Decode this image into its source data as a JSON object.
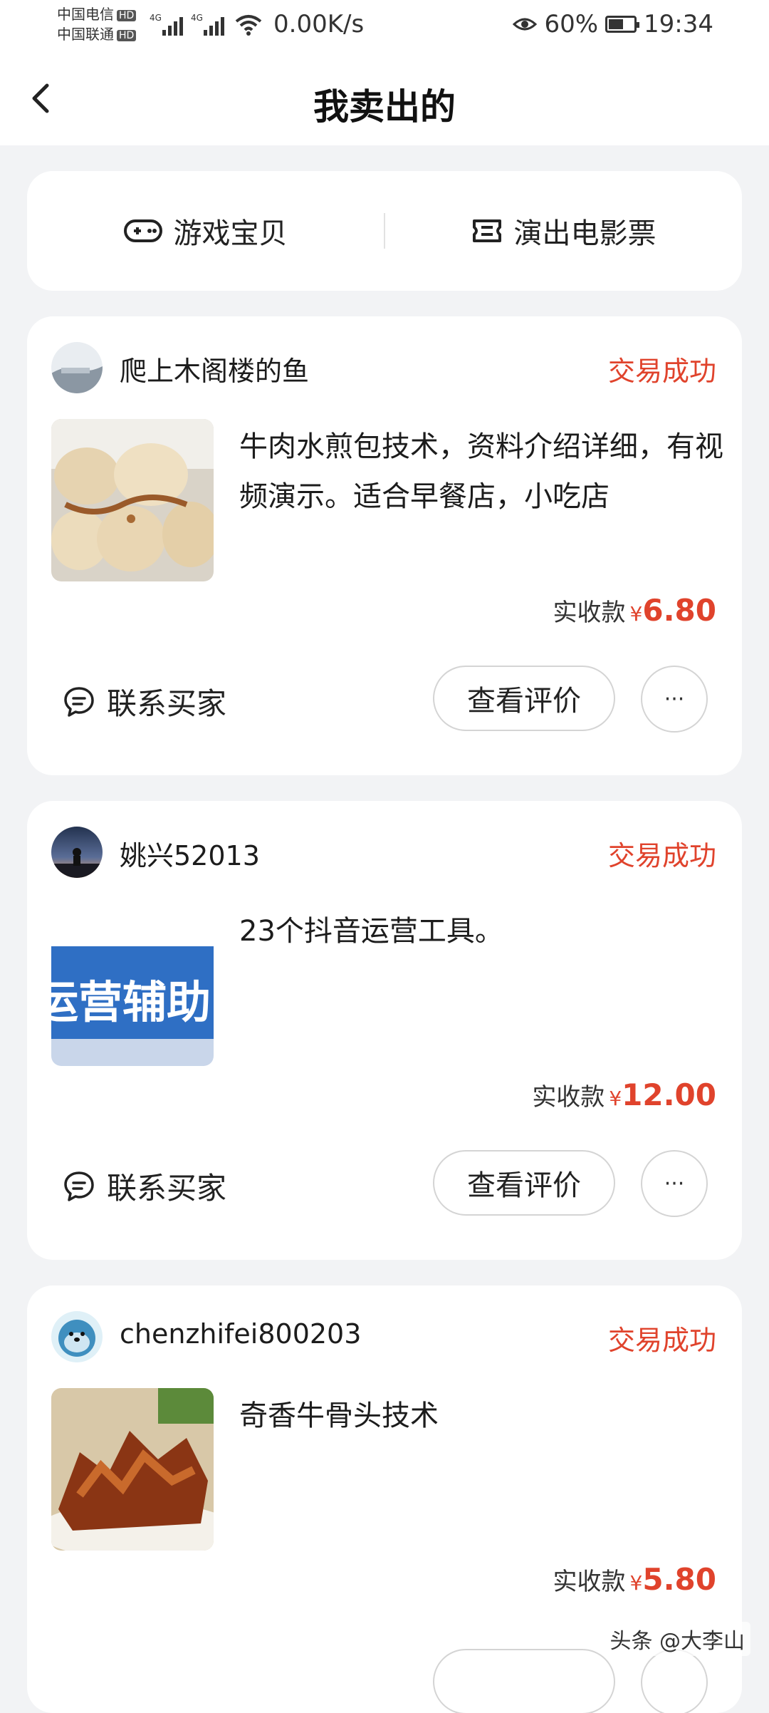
{
  "status_bar": {
    "carrier1": "中国电信",
    "carrier2": "中国联通",
    "hd_badge": "HD",
    "network1": "4G",
    "network2": "4G",
    "net_speed": "0.00K/s",
    "battery_percent": "60%",
    "battery_level": 0.6,
    "time": "19:34"
  },
  "nav": {
    "title": "我卖出的",
    "back_icon": "chevron-left-icon"
  },
  "tabs": [
    {
      "label": "游戏宝贝",
      "icon": "gamepad-icon"
    },
    {
      "label": "演出电影票",
      "icon": "ticket-icon"
    }
  ],
  "orders": [
    {
      "user": "爬上木阁楼的鱼",
      "status": "交易成功",
      "description": "牛肉水煎包技术，资料介绍详细，有视频演示。适合早餐店，小吃店",
      "amount_label": "实收款",
      "currency": "¥",
      "amount": "6.80",
      "contact_label": "联系买家",
      "review_label": "查看评价",
      "more_label": "···"
    },
    {
      "user": "姚兴52013",
      "status": "交易成功",
      "description": "23个抖音运营工具。",
      "thumb_text": "运营辅助",
      "amount_label": "实收款",
      "currency": "¥",
      "amount": "12.00",
      "contact_label": "联系买家",
      "review_label": "查看评价",
      "more_label": "···"
    },
    {
      "user": "chenzhifei800203",
      "status": "交易成功",
      "description": "奇香牛骨头技术",
      "amount_label": "实收款",
      "currency": "¥",
      "amount": "5.80"
    }
  ],
  "watermark": "头条 @大李山",
  "colors": {
    "accent_red": "#e0432c",
    "background": "#f2f3f5",
    "card": "#ffffff"
  }
}
